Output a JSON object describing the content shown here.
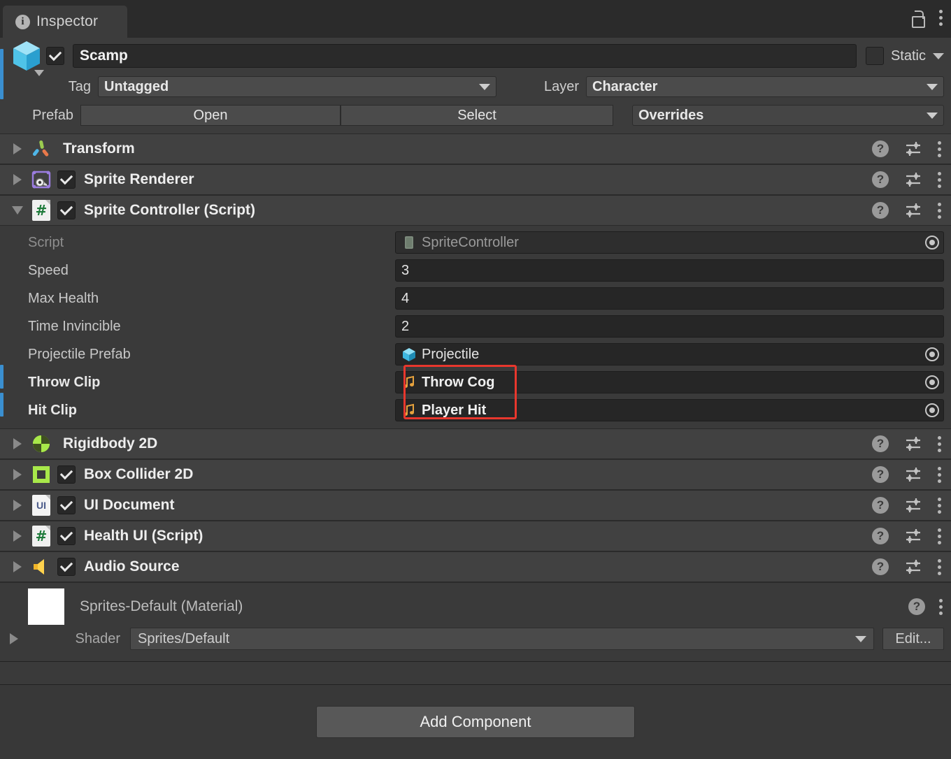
{
  "tab": {
    "label": "Inspector",
    "info_icon": "info-icon",
    "lock_icon": "lock-icon",
    "menu_icon": "kebab-menu-icon"
  },
  "object_header": {
    "icon": "gameobject-cube-icon",
    "active_checked": true,
    "name": "Scamp",
    "static_label": "Static",
    "static_checked": false,
    "tag_label": "Tag",
    "tag_value": "Untagged",
    "layer_label": "Layer",
    "layer_value": "Character",
    "prefab_label": "Prefab",
    "open_label": "Open",
    "select_label": "Select",
    "overrides_label": "Overrides"
  },
  "components": [
    {
      "name": "Transform",
      "icon": "transform-icon",
      "expanded": false,
      "has_toggle": false,
      "enabled": false
    },
    {
      "name": "Sprite Renderer",
      "icon": "sprite-renderer-icon",
      "expanded": false,
      "has_toggle": true,
      "enabled": true
    },
    {
      "name": "Sprite Controller (Script)",
      "icon": "csharp-script-icon",
      "expanded": true,
      "has_toggle": true,
      "enabled": true
    }
  ],
  "sprite_controller_properties": [
    {
      "label": "Script",
      "value": "SpriteController",
      "type": "object",
      "icon": "script-asset-icon",
      "readonly": true,
      "modified": false
    },
    {
      "label": "Speed",
      "value": "3",
      "type": "number",
      "icon": "",
      "readonly": false,
      "modified": false
    },
    {
      "label": "Max Health",
      "value": "4",
      "type": "number",
      "icon": "",
      "readonly": false,
      "modified": false
    },
    {
      "label": "Time Invincible",
      "value": "2",
      "type": "number",
      "icon": "",
      "readonly": false,
      "modified": false
    },
    {
      "label": "Projectile Prefab",
      "value": "Projectile",
      "type": "object",
      "icon": "prefab-icon",
      "readonly": false,
      "modified": false
    },
    {
      "label": "Throw Clip",
      "value": "Throw Cog",
      "type": "object",
      "icon": "audio-clip-icon",
      "readonly": false,
      "modified": true
    },
    {
      "label": "Hit Clip",
      "value": "Player Hit",
      "type": "object",
      "icon": "audio-clip-icon",
      "readonly": false,
      "modified": true
    }
  ],
  "components_lower": [
    {
      "name": "Rigidbody 2D",
      "icon": "rigidbody2d-icon",
      "expanded": false,
      "has_toggle": false,
      "enabled": false
    },
    {
      "name": "Box Collider 2D",
      "icon": "boxcollider2d-icon",
      "expanded": false,
      "has_toggle": true,
      "enabled": true
    },
    {
      "name": "UI Document",
      "icon": "ui-document-icon",
      "expanded": false,
      "has_toggle": true,
      "enabled": true
    },
    {
      "name": "Health UI (Script)",
      "icon": "csharp-script-icon",
      "expanded": false,
      "has_toggle": true,
      "enabled": true
    },
    {
      "name": "Audio Source",
      "icon": "audio-source-icon",
      "expanded": false,
      "has_toggle": true,
      "enabled": true
    }
  ],
  "material": {
    "title": "Sprites-Default (Material)",
    "swatch_color": "#ffffff",
    "shader_label": "Shader",
    "shader_value": "Sprites/Default",
    "edit_label": "Edit...",
    "help_icon": "help-icon",
    "menu_icon": "kebab-menu-icon"
  },
  "footer": {
    "add_component_label": "Add Component"
  },
  "row_icons": {
    "help": "help-icon",
    "preset": "preset-sliders-icon",
    "menu": "kebab-menu-icon"
  },
  "colors": {
    "panel_bg": "#3a3a3a",
    "component_header_bg": "#414141",
    "field_bg": "#262626",
    "prefab_override_marker": "#3a8fd0",
    "annotation_red": "#e8372d",
    "audio_clip_icon": "#e8a33d",
    "accent_blue": "#4fc3f7"
  },
  "annotation": {
    "shape": "rectangle",
    "color": "#e8372d",
    "targets": [
      "Throw Cog",
      "Player Hit"
    ]
  }
}
